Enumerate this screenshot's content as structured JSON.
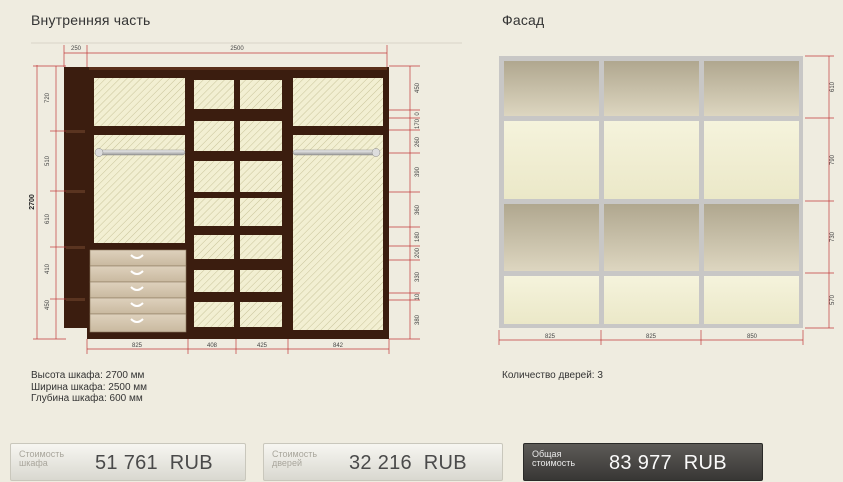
{
  "interior": {
    "title": "Внутренняя часть",
    "top_dims": [
      "250",
      "2500"
    ],
    "height_dim": "2700",
    "left_dims": [
      "720",
      "510",
      "610",
      "410",
      "450"
    ],
    "right_dims": [
      "450",
      "0",
      "170",
      "260",
      "390",
      "360",
      "180",
      "200",
      "330",
      "10",
      "380"
    ],
    "bottom_dims": [
      "825",
      "408",
      "425",
      "842"
    ]
  },
  "facade": {
    "title": "Фасад",
    "right_dims": [
      "610",
      "790",
      "730",
      "570"
    ],
    "bottom_dims": [
      "825",
      "825",
      "850"
    ]
  },
  "specs": {
    "height": "Высота шкафа: 2700 мм",
    "width": "Ширина шкафа: 2500 мм",
    "depth": "Глубина шкафа: 600 мм",
    "doors": "Количество дверей: 3"
  },
  "prices": {
    "cabinet": {
      "label_line1": "Стоимость",
      "label_line2": "шкафа",
      "value": "51 761",
      "currency": "RUB"
    },
    "doors": {
      "label_line1": "Стоимость",
      "label_line2": "дверей",
      "value": "32 216",
      "currency": "RUB"
    },
    "total": {
      "label_line1": "Общая",
      "label_line2": "стоимость",
      "value": "83 977",
      "currency": "RUB"
    }
  },
  "colors": {
    "wood": "#3b1d0f",
    "panel_fill": "#f2efd2",
    "dim_line": "#c23a3a",
    "facade_dark": "#bdb39e",
    "facade_light": "#efeccf"
  }
}
